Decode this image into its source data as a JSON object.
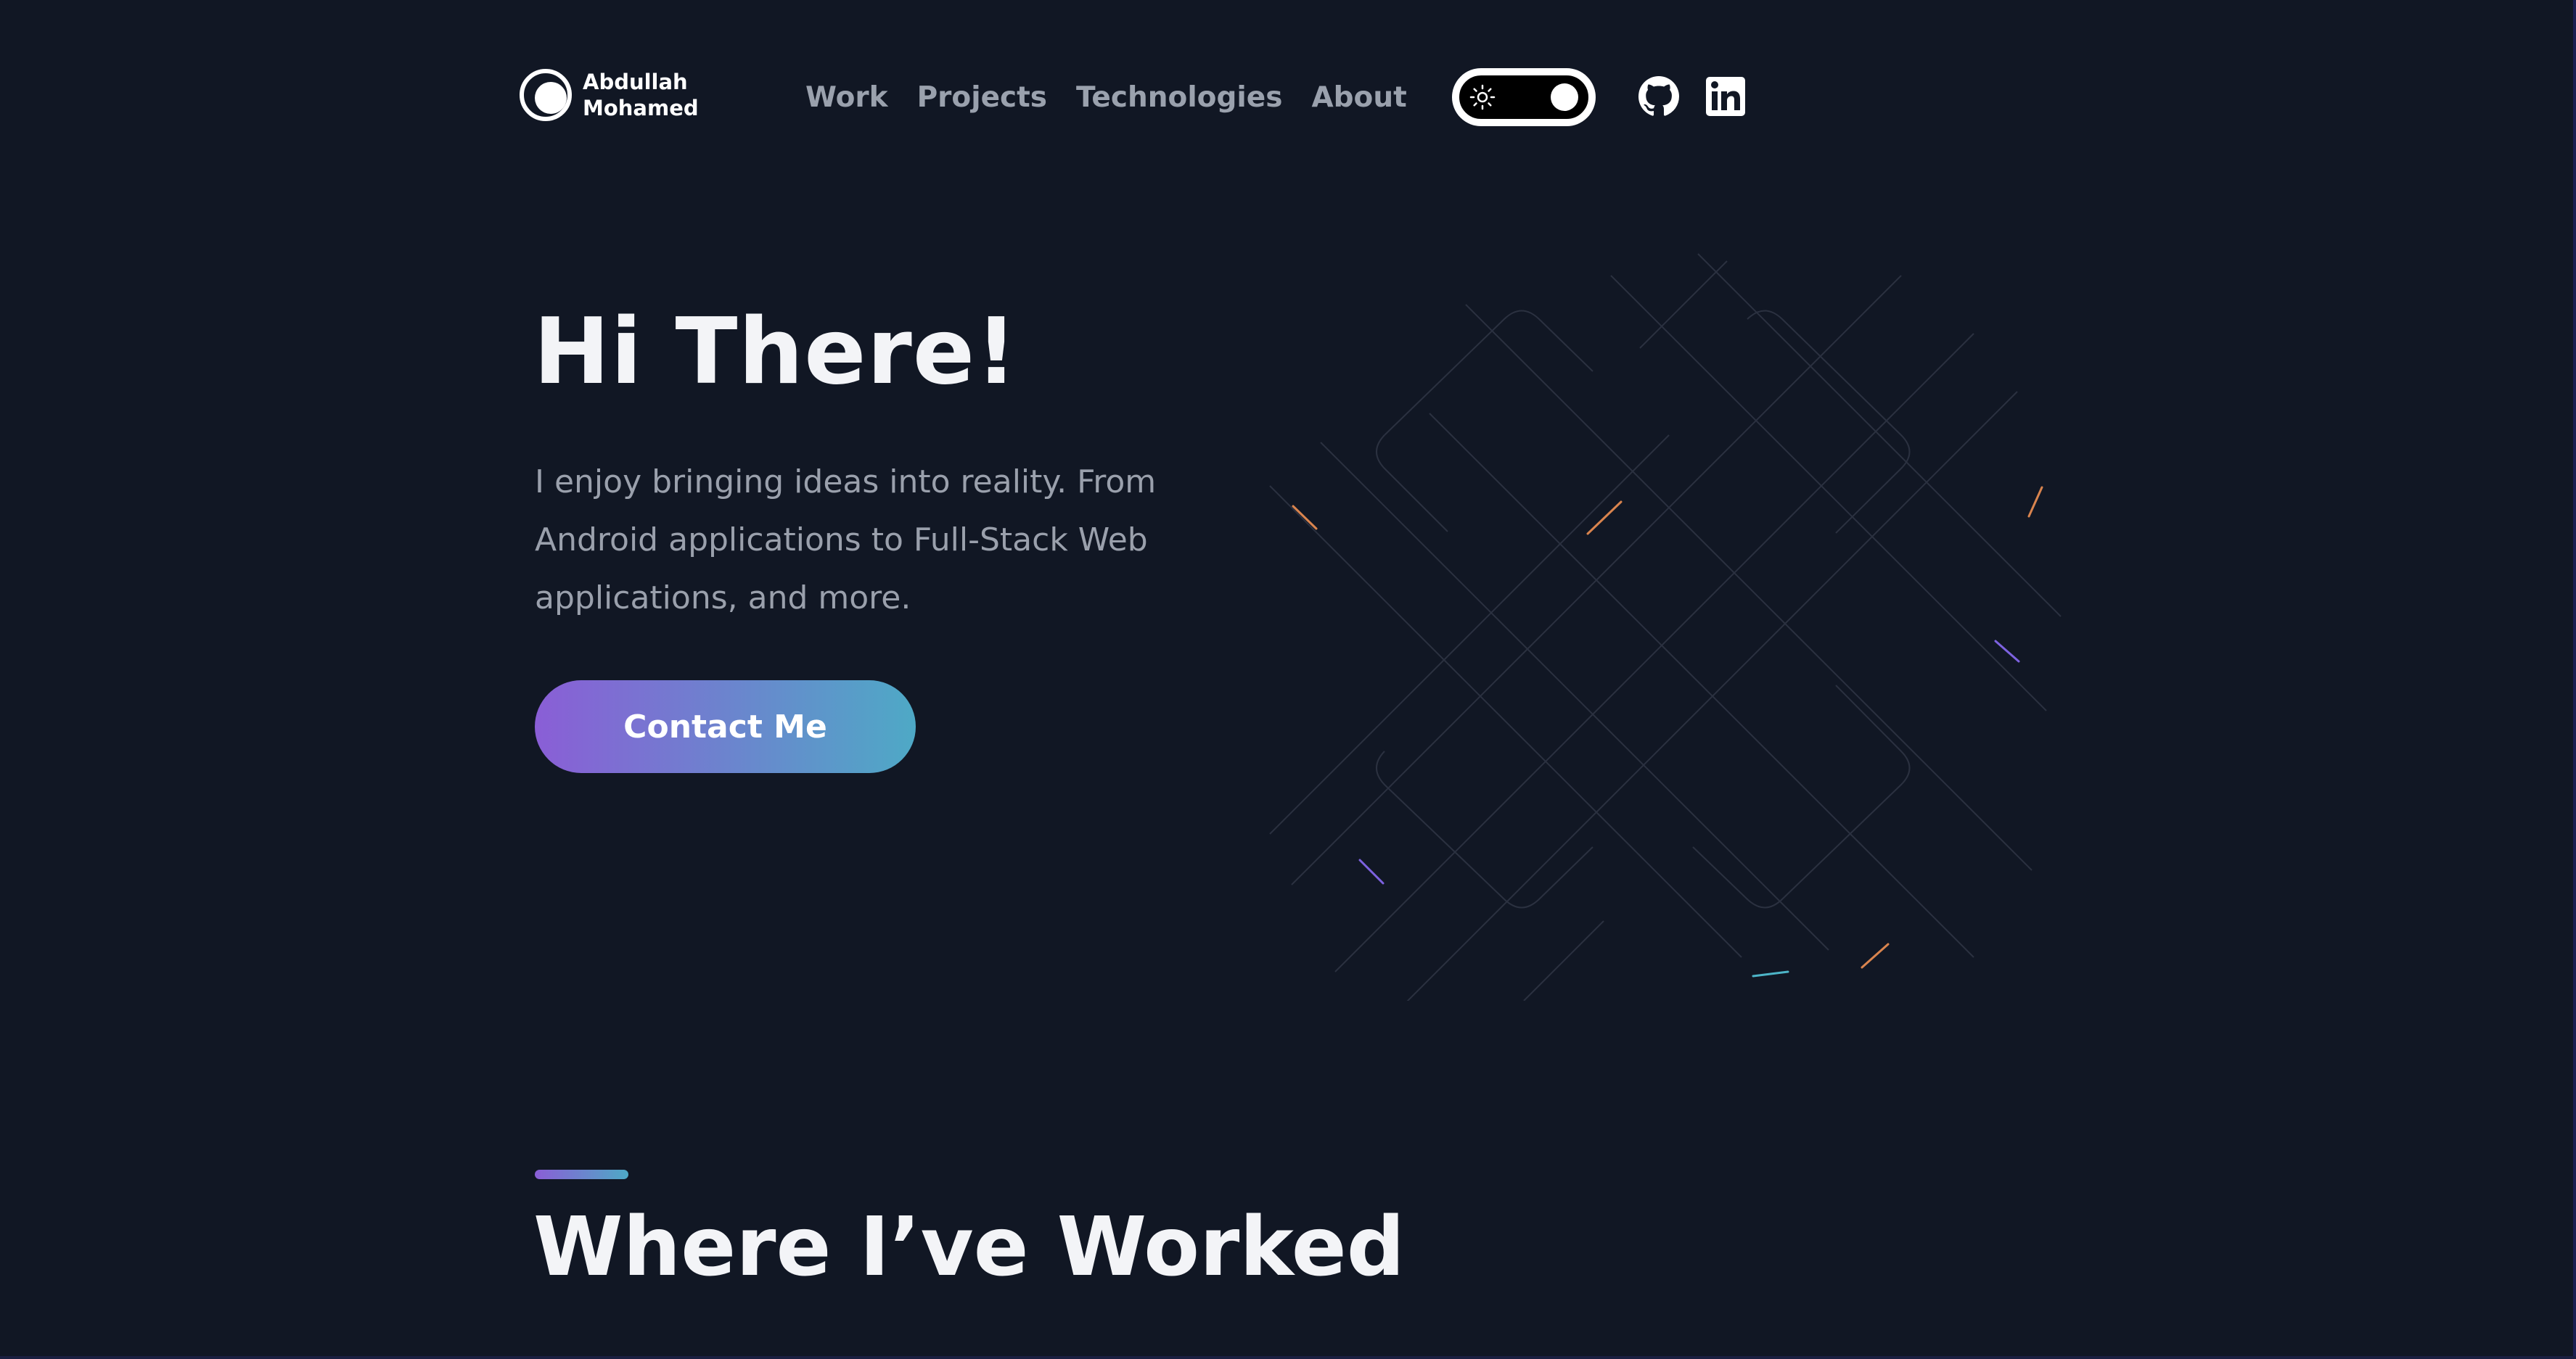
{
  "header": {
    "logo": {
      "first_name": "Abdullah",
      "last_name": "Mohamed",
      "icon": "logo-mark-icon"
    },
    "nav": [
      {
        "label": "Work"
      },
      {
        "label": "Projects"
      },
      {
        "label": "Technologies"
      },
      {
        "label": "About"
      }
    ],
    "theme_toggle": {
      "icon": "sun-icon",
      "state": "dark"
    },
    "social": [
      {
        "icon": "github-icon"
      },
      {
        "icon": "linkedin-icon"
      }
    ]
  },
  "hero": {
    "title": "Hi There!",
    "description": "I enjoy bringing ideas into reality. From Android applications to Full-Stack Web applications, and more.",
    "cta_label": "Contact Me",
    "illustration": "grid-lines-art"
  },
  "section": {
    "title": "Where I’ve Worked"
  },
  "colors": {
    "background": "#111724",
    "text_primary": "#f3f4f7",
    "text_muted": "#9aa0ac",
    "nav_text": "#9aa1ad",
    "gradient_start": "#8a5ed6",
    "gradient_end": "#4ea9c6"
  }
}
